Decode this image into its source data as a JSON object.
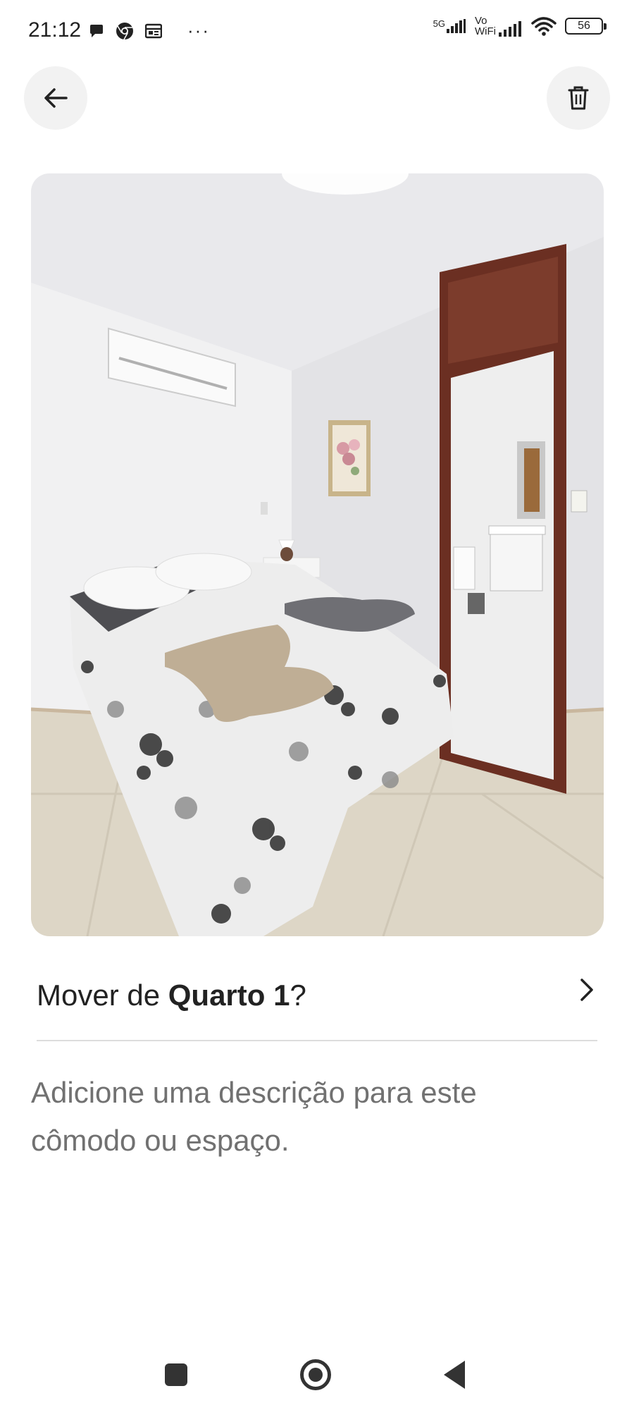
{
  "status_bar": {
    "time": "21:12",
    "network_5g": "5G",
    "vowifi_top": "Vo",
    "vowifi_bottom": "WiFi",
    "battery": "56",
    "more": "···"
  },
  "icons": {
    "back": "arrow-left-icon",
    "delete": "trash-icon",
    "chevron": "chevron-right-icon"
  },
  "photo": {
    "subject": "bedroom-photo"
  },
  "move_row": {
    "prefix": "Mover de ",
    "room": "Quarto 1",
    "suffix": "?"
  },
  "description": {
    "placeholder": "Adicione uma descrição para este cômodo ou espaço."
  },
  "colors": {
    "text_primary": "#222222",
    "text_secondary": "#717171",
    "divider": "#dddddd",
    "button_bg": "#f2f2f2"
  }
}
